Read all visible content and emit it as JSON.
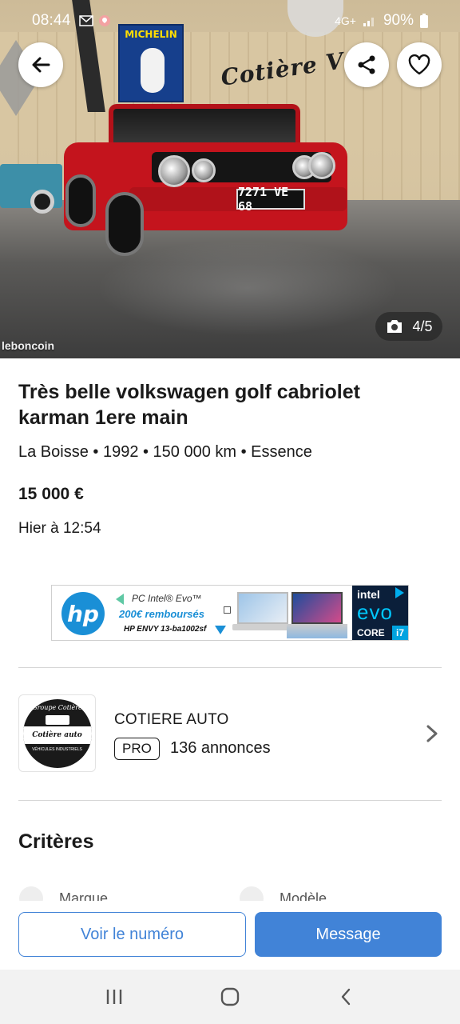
{
  "status_bar": {
    "time": "08:44",
    "network": "4G+",
    "battery": "90%"
  },
  "gallery": {
    "counter": "4/5",
    "watermark": "leboncoin",
    "plate_text": "7271 VE 68",
    "poster_text": "MICHELIN",
    "wall_text": "Cotière V"
  },
  "listing": {
    "title": "Très belle volkswagen golf cabriolet karman 1ere main",
    "meta": "La Boisse • 1992 • 150 000 km • Essence",
    "price": "15 000 €",
    "date": "Hier à 12:54"
  },
  "ad": {
    "brand": "hp",
    "line1": "PC Intel® Evo™",
    "line2": "200€ remboursés",
    "line3": "HP ENVY 13-ba1002sf",
    "intel_top": "intel",
    "intel_mid": "evo",
    "intel_core": "CORE",
    "intel_gen": "i7"
  },
  "seller": {
    "name": "COTIERE AUTO",
    "badge": "PRO",
    "listings": "136 annonces",
    "logo_arc": "Groupe Cotière",
    "logo_band": "Cotière auto",
    "logo_sub": "VÉHICULES INDUSTRIELS"
  },
  "criteria": {
    "title": "Critères",
    "items": [
      "Marque",
      "Modèle"
    ]
  },
  "actions": {
    "call_label": "Voir le numéro",
    "message_label": "Message"
  },
  "colors": {
    "accent": "#4183d7",
    "car_red": "#c4141d"
  }
}
